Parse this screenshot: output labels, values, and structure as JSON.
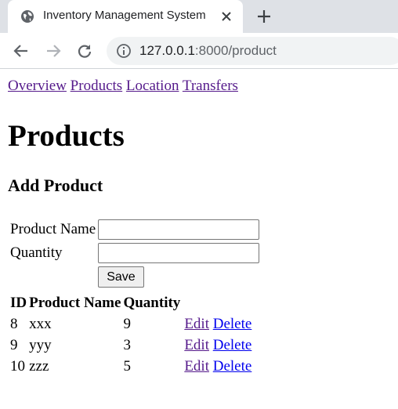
{
  "browser": {
    "tab_title": "Inventory Management System",
    "url_host": "127.0.0.1",
    "url_rest": ":8000/product"
  },
  "nav": {
    "links": [
      "Overview",
      "Products",
      "Location",
      "Transfers"
    ]
  },
  "page": {
    "title": "Products",
    "form_heading": "Add Product"
  },
  "form": {
    "name_label": "Product Name",
    "name_value": "",
    "quantity_label": "Quantity",
    "quantity_value": "",
    "save_label": "Save"
  },
  "table": {
    "headers": [
      "ID",
      "Product Name",
      "Quantity"
    ],
    "rows": [
      {
        "id": "8",
        "name": "xxx",
        "quantity": "9",
        "edit": "Edit",
        "delete": "Delete"
      },
      {
        "id": "9",
        "name": "yyy",
        "quantity": "3",
        "edit": "Edit",
        "delete": "Delete"
      },
      {
        "id": "10",
        "name": "zzz",
        "quantity": "5",
        "edit": "Edit",
        "delete": "Delete"
      }
    ]
  },
  "colors": {
    "visited_link": "#551a8b",
    "link": "#0000ee",
    "tabstrip": "#dee1e6"
  }
}
